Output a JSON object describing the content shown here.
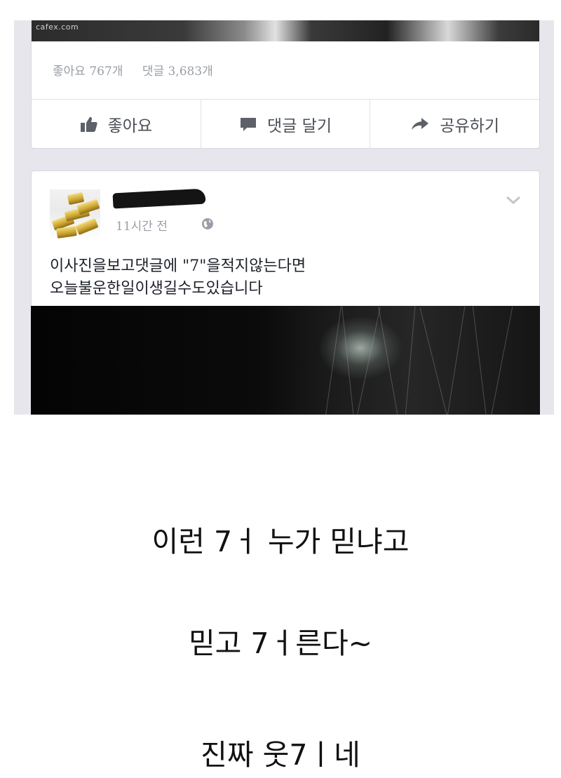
{
  "screenshot": {
    "watermark": "cafex.com",
    "previous_post": {
      "likes_text": "좋아요 767개",
      "comments_text": "댓글 3,683개",
      "actions": {
        "like_label": "좋아요",
        "comment_label": "댓글 달기",
        "share_label": "공유하기"
      }
    },
    "post": {
      "author_name": "",
      "time": "11시간 전",
      "text_line1": "이사진을보고댓글에 \"7\"을적지않는다면",
      "text_line2": "오늘불운한일이생길수도있습니다"
    },
    "icons": {
      "like": "thumbs-up-icon",
      "comment": "speech-bubble-icon",
      "share": "share-arrow-icon",
      "privacy": "globe-icon",
      "menu": "chevron-down-icon"
    }
  },
  "caption": {
    "line1": "이런 7ㅓ 누가 믿냐고",
    "line2": "믿고 7ㅓ른다~",
    "line3": "진짜 웃7ㅣ네"
  },
  "colors": {
    "feed_background": "#e6e6ec",
    "meta_text": "#9a9ea7",
    "action_text": "#4b4f56",
    "post_text": "#1d2129"
  }
}
